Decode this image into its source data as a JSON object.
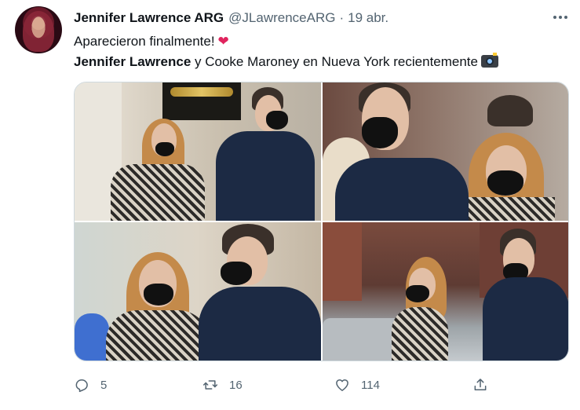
{
  "tweet": {
    "display_name": "Jennifer Lawrence ARG",
    "handle": "@JLawrenceARG",
    "separator": "·",
    "date": "19 abr.",
    "line1": "Aparecieron finalmente!",
    "line1_emoji": "❤",
    "line2_bold": "Jennifer Lawrence",
    "line2_rest": " y Cooke Maroney en Nueva York recientemente",
    "line2_emoji": "camera-with-flash-emoji"
  },
  "media": {
    "count": 4,
    "photos": [
      "street-photo-1",
      "street-photo-2",
      "street-photo-3",
      "street-photo-4"
    ]
  },
  "actions": {
    "replies": "5",
    "retweets": "16",
    "likes": "114",
    "reply_icon": "reply-icon",
    "retweet_icon": "retweet-icon",
    "like_icon": "heart-icon",
    "share_icon": "share-icon"
  },
  "colors": {
    "text": "#0f1419",
    "muted": "#536471",
    "heart": "#e0245e",
    "border": "#cfd9de"
  }
}
